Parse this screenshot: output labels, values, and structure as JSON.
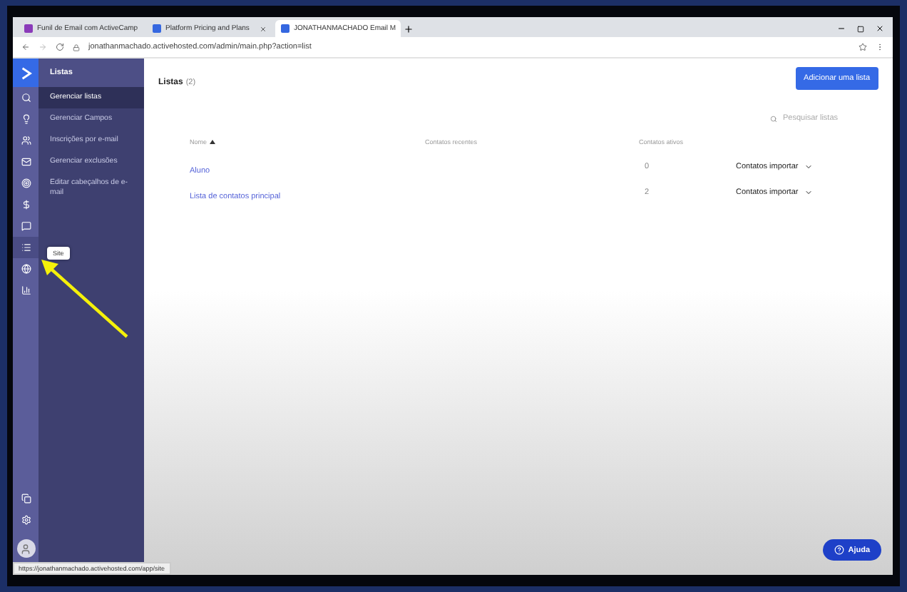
{
  "browser": {
    "tabs": [
      {
        "title": "Funil de Email com ActiveCamp",
        "selected": false
      },
      {
        "title": "Platform Pricing and Plans",
        "selected": false
      },
      {
        "title": "JONATHANMACHADO Email M",
        "selected": true
      }
    ],
    "url": "jonathanmachado.activehosted.com/admin/main.php?action=list",
    "status_url": "https://jonathanmachado.activehosted.com/app/site"
  },
  "rail": {
    "items": [
      {
        "selected": false
      },
      {
        "selected": false
      },
      {
        "selected": false
      },
      {
        "selected": false
      },
      {
        "selected": false
      },
      {
        "selected": false
      },
      {
        "selected": false
      },
      {
        "selected": true
      },
      {
        "selected": false
      },
      {
        "selected": false
      }
    ],
    "tooltip": "Site"
  },
  "subnav": {
    "title": "Listas",
    "items": [
      {
        "label": "Gerenciar listas",
        "selected": true
      },
      {
        "label": "Gerenciar Campos",
        "selected": false
      },
      {
        "label": "Inscrições por e-mail",
        "selected": false
      },
      {
        "label": "Gerenciar exclusões",
        "selected": false
      },
      {
        "label": "Editar cabeçalhos de e-mail",
        "selected": false
      }
    ]
  },
  "page": {
    "title": "Listas",
    "count": "(2)",
    "add_button": "Adicionar uma lista",
    "search": {
      "placeholder": "Pesquisar listas"
    },
    "table": {
      "columns": [
        "Nome",
        "Contatos recentes",
        "Contatos ativos"
      ],
      "rows": [
        {
          "name": "Aluno",
          "active": "0",
          "action": "Contatos importar"
        },
        {
          "name": "Lista de contatos principal",
          "active": "2",
          "action": "Contatos importar"
        }
      ]
    }
  },
  "help_button": "Ajuda"
}
